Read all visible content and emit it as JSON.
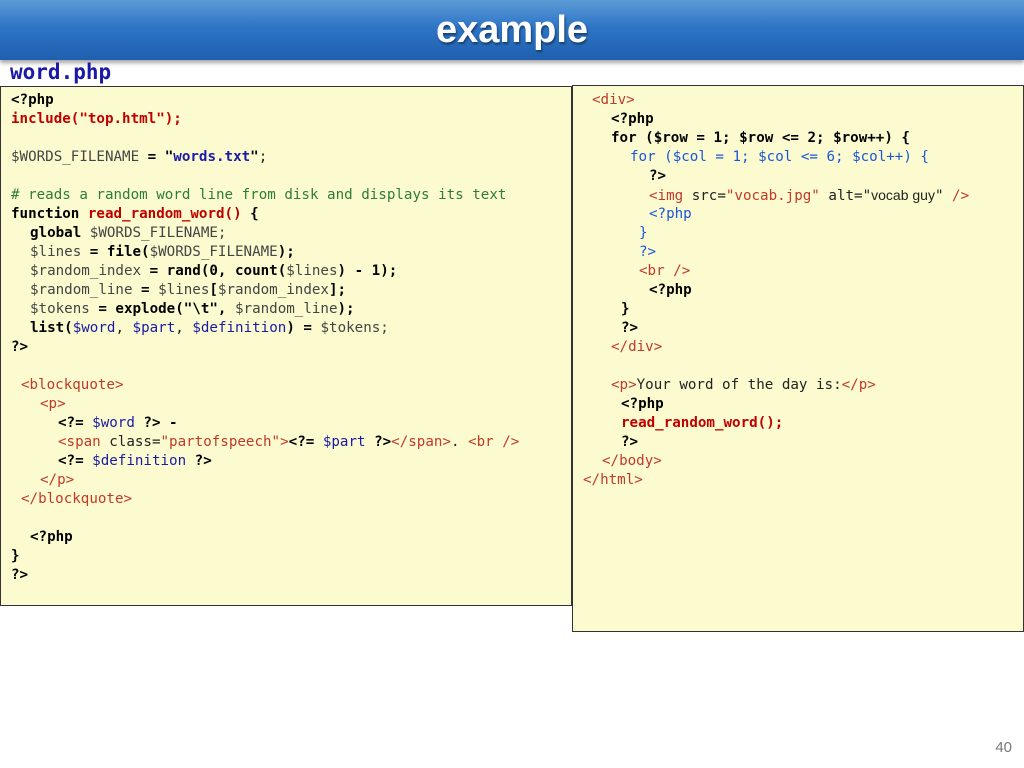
{
  "slide": {
    "title": "example",
    "filename": "word.php",
    "page_number": "40"
  },
  "left_code": {
    "php_open": "<?php",
    "include_kw": "include",
    "include_arg": "(\"top.html\");",
    "words_var": "$WORDS_FILENAME",
    "words_eq": " = ",
    "words_q1": "\"",
    "words_val": "words.txt",
    "words_q2": "\"",
    "words_semi": ";",
    "comment": "# reads a random word line from disk and displays its text",
    "function_kw": "function ",
    "function_name": "read_random_word()",
    "function_brace": " {",
    "global_kw": "global",
    "global_var": " $WORDS_FILENAME;",
    "lines_var": "$lines",
    "lines_eq": " = ",
    "file_fn": "file(",
    "file_arg": "$WORDS_FILENAME",
    "file_close": ");",
    "ri_var": "$random_index",
    "ri_eq": " = ",
    "rand_fn": "rand(0, count(",
    "ri_arg": "$lines",
    "ri_close": ") - 1);",
    "rl_var": "$random_line",
    "rl_eq": " = ",
    "rl_lines": "$lines",
    "rl_open": "[",
    "rl_idx": "$random_index",
    "rl_close": "];",
    "tok_var": "$tokens",
    "tok_eq": " = ",
    "explode_fn": "explode(\"\\t\", ",
    "tok_arg": "$random_line",
    "tok_close": ");",
    "list_kw": "list(",
    "list_word": "$word",
    "list_c1": ", ",
    "list_part": "$part",
    "list_c2": ", ",
    "list_def": "$definition",
    "list_close": ") = ",
    "list_tokens": "$tokens;",
    "php_close_1": "?>",
    "bq_open": "<blockquote>",
    "p_open": "<p>",
    "echo_open_1": "<?= ",
    "echo_word": "$word",
    "echo_close_1": " ?> -",
    "span_open": "<span",
    "span_attr": " class=",
    "span_attrv": "\"partofspeech\"",
    "span_gt": ">",
    "echo_open_2": "<?= ",
    "echo_part": "$part",
    "echo_close_2": " ?>",
    "span_close": "</span>",
    "dot": ". ",
    "br_tag": "<br />",
    "echo_open_3": "<?= ",
    "echo_def": "$definition",
    "echo_close_3": " ?>",
    "p_close": "</p>",
    "bq_close": "</blockquote>",
    "php_open_2": "<?php",
    "brace_close": "}",
    "php_close_2": "?>"
  },
  "right_code": {
    "div_open": "<div>",
    "php_open": "<?php",
    "for1": "for ($row = 1; $row <= 2; $row++) {",
    "for2": "for ($col = 1; $col <= 6; $col++) {",
    "php_close_a": "?>",
    "img_open": "<img",
    "img_src_attr": " src=",
    "img_src_val": "\"vocab.jpg\"",
    "img_alt_attr": " alt=",
    "img_alt_q1": "\"",
    "img_alt_val": "vocab guy",
    "img_alt_q2": "\"",
    "img_end": " />",
    "php_open_b": "<?php",
    "brace_a": "}",
    "php_close_b": "?>",
    "br_tag": "<br />",
    "php_open_c": "<?php",
    "brace_b": "}",
    "php_close_c": "?>",
    "div_close": "</div>",
    "p_open": "<p>",
    "p_text": "Your word of the day is:",
    "p_close": "</p>",
    "php_open_d": "<?php",
    "call": "read_random_word();",
    "php_close_d": "?>",
    "body_close": "</body>",
    "html_close": "</html>"
  }
}
